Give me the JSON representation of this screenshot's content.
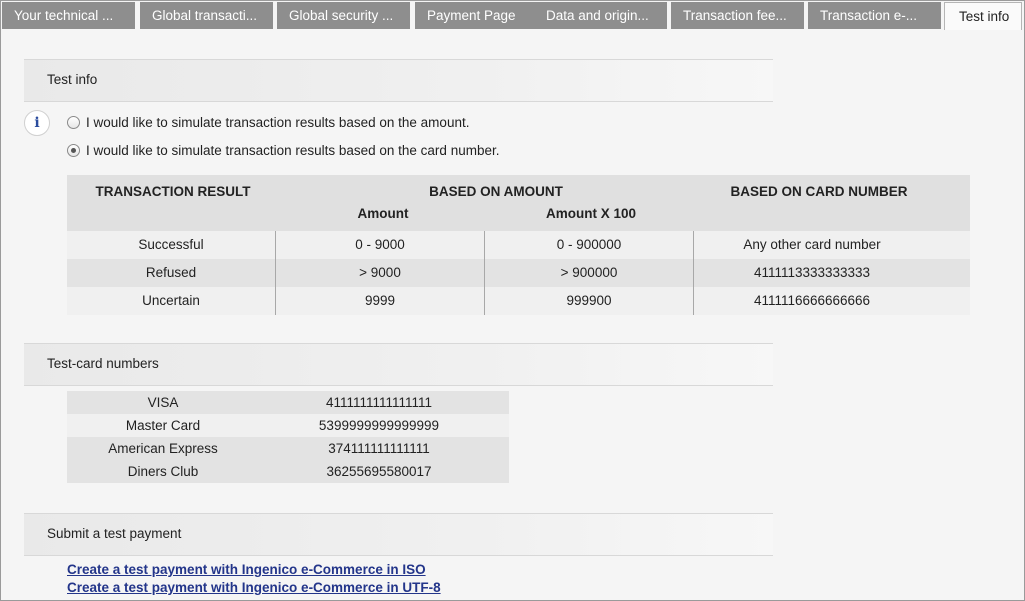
{
  "tabs": [
    {
      "label": "Your technical ..."
    },
    {
      "label": "Global transacti..."
    },
    {
      "label": "Global security ..."
    },
    {
      "label": "Payment Page"
    },
    {
      "label": "Data and origin..."
    },
    {
      "label": "Transaction fee..."
    },
    {
      "label": "Transaction e-..."
    },
    {
      "label": "Test info"
    }
  ],
  "active_tab": "Test info",
  "sections": {
    "test_info": "Test info",
    "test_cards": "Test-card numbers",
    "submit": "Submit a test payment"
  },
  "options": {
    "amount": "I would like to simulate transaction results based on the amount.",
    "card": "I would like to simulate transaction results based on the card number.",
    "selected": "card"
  },
  "results_table": {
    "headers": {
      "result": "TRANSACTION RESULT",
      "based_amount": "BASED ON AMOUNT",
      "amount": "Amount",
      "amount_x100": "Amount X 100",
      "based_card": "BASED ON CARD NUMBER"
    },
    "rows": [
      {
        "result": "Successful",
        "amount": "0 - 9000",
        "amount_x100": "0 - 900000",
        "card": "Any other card number"
      },
      {
        "result": "Refused",
        "amount": "> 9000",
        "amount_x100": "> 900000",
        "card": "4111113333333333"
      },
      {
        "result": "Uncertain",
        "amount": "9999",
        "amount_x100": "999900",
        "card": "4111116666666666"
      }
    ]
  },
  "test_cards": [
    {
      "name": "VISA",
      "number": "4111111111111111"
    },
    {
      "name": "Master Card",
      "number": "5399999999999999"
    },
    {
      "name": "American Express",
      "number": "374111111111111"
    },
    {
      "name": "Diners Club",
      "number": "36255695580017"
    }
  ],
  "links": {
    "iso": "Create a test payment with Ingenico e-Commerce in ISO",
    "utf8": "Create a test payment with Ingenico e-Commerce in UTF-8"
  },
  "icons": {
    "info": "i"
  },
  "colors": {
    "tab_inactive": "#8e8e8e",
    "link": "#23358a"
  }
}
